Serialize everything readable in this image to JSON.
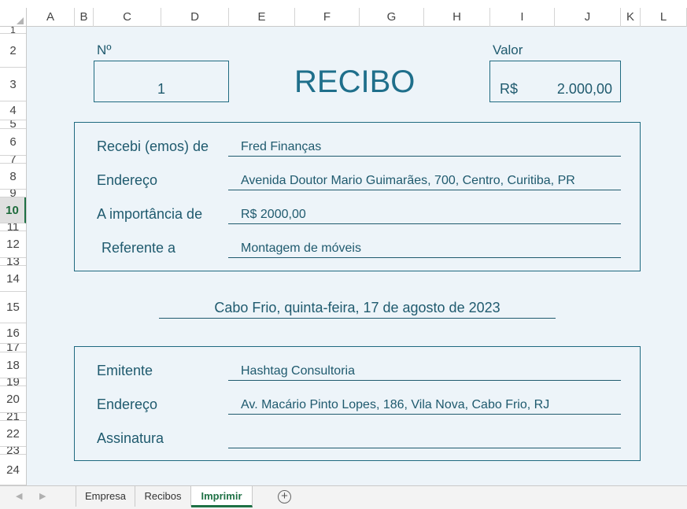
{
  "columns": [
    "A",
    "B",
    "C",
    "D",
    "E",
    "F",
    "G",
    "H",
    "I",
    "J",
    "K",
    "L"
  ],
  "rows": [
    "1",
    "2",
    "3",
    "4",
    "5",
    "6",
    "7",
    "8",
    "9",
    "10",
    "11",
    "12",
    "13",
    "14",
    "15",
    "16",
    "17",
    "18",
    "19",
    "20",
    "21",
    "22",
    "23",
    "24"
  ],
  "active_row": "10",
  "receipt": {
    "number_label": "Nº",
    "number": "1",
    "title": "RECIBO",
    "value_label": "Valor",
    "currency": "R$",
    "amount": "2.000,00",
    "payer": {
      "received_from_label": "Recebi (emos) de",
      "received_from": "Fred Finanças",
      "address_label": "Endereço",
      "address": "Avenida Doutor Mario Guimarães, 700, Centro, Curitiba, PR",
      "amount_label": "A importância de",
      "amount_text": "R$ 2000,00",
      "reference_label": "Referente a",
      "reference": "Montagem de móveis"
    },
    "place_date": "Cabo Frio, quinta-feira, 17 de agosto de 2023",
    "issuer": {
      "issuer_label": "Emitente",
      "issuer": "Hashtag Consultoria",
      "address_label": "Endereço",
      "address": "Av. Macário Pinto Lopes, 186, Vila Nova, Cabo Frio, RJ",
      "signature_label": "Assinatura"
    }
  },
  "tabs": [
    {
      "label": "Empresa",
      "active": false
    },
    {
      "label": "Recibos",
      "active": false
    },
    {
      "label": "Imprimir",
      "active": true
    }
  ],
  "colors": {
    "accent": "#1f5a6e",
    "sheet_background": "#edf4f9",
    "active_tab": "#1e7145"
  }
}
